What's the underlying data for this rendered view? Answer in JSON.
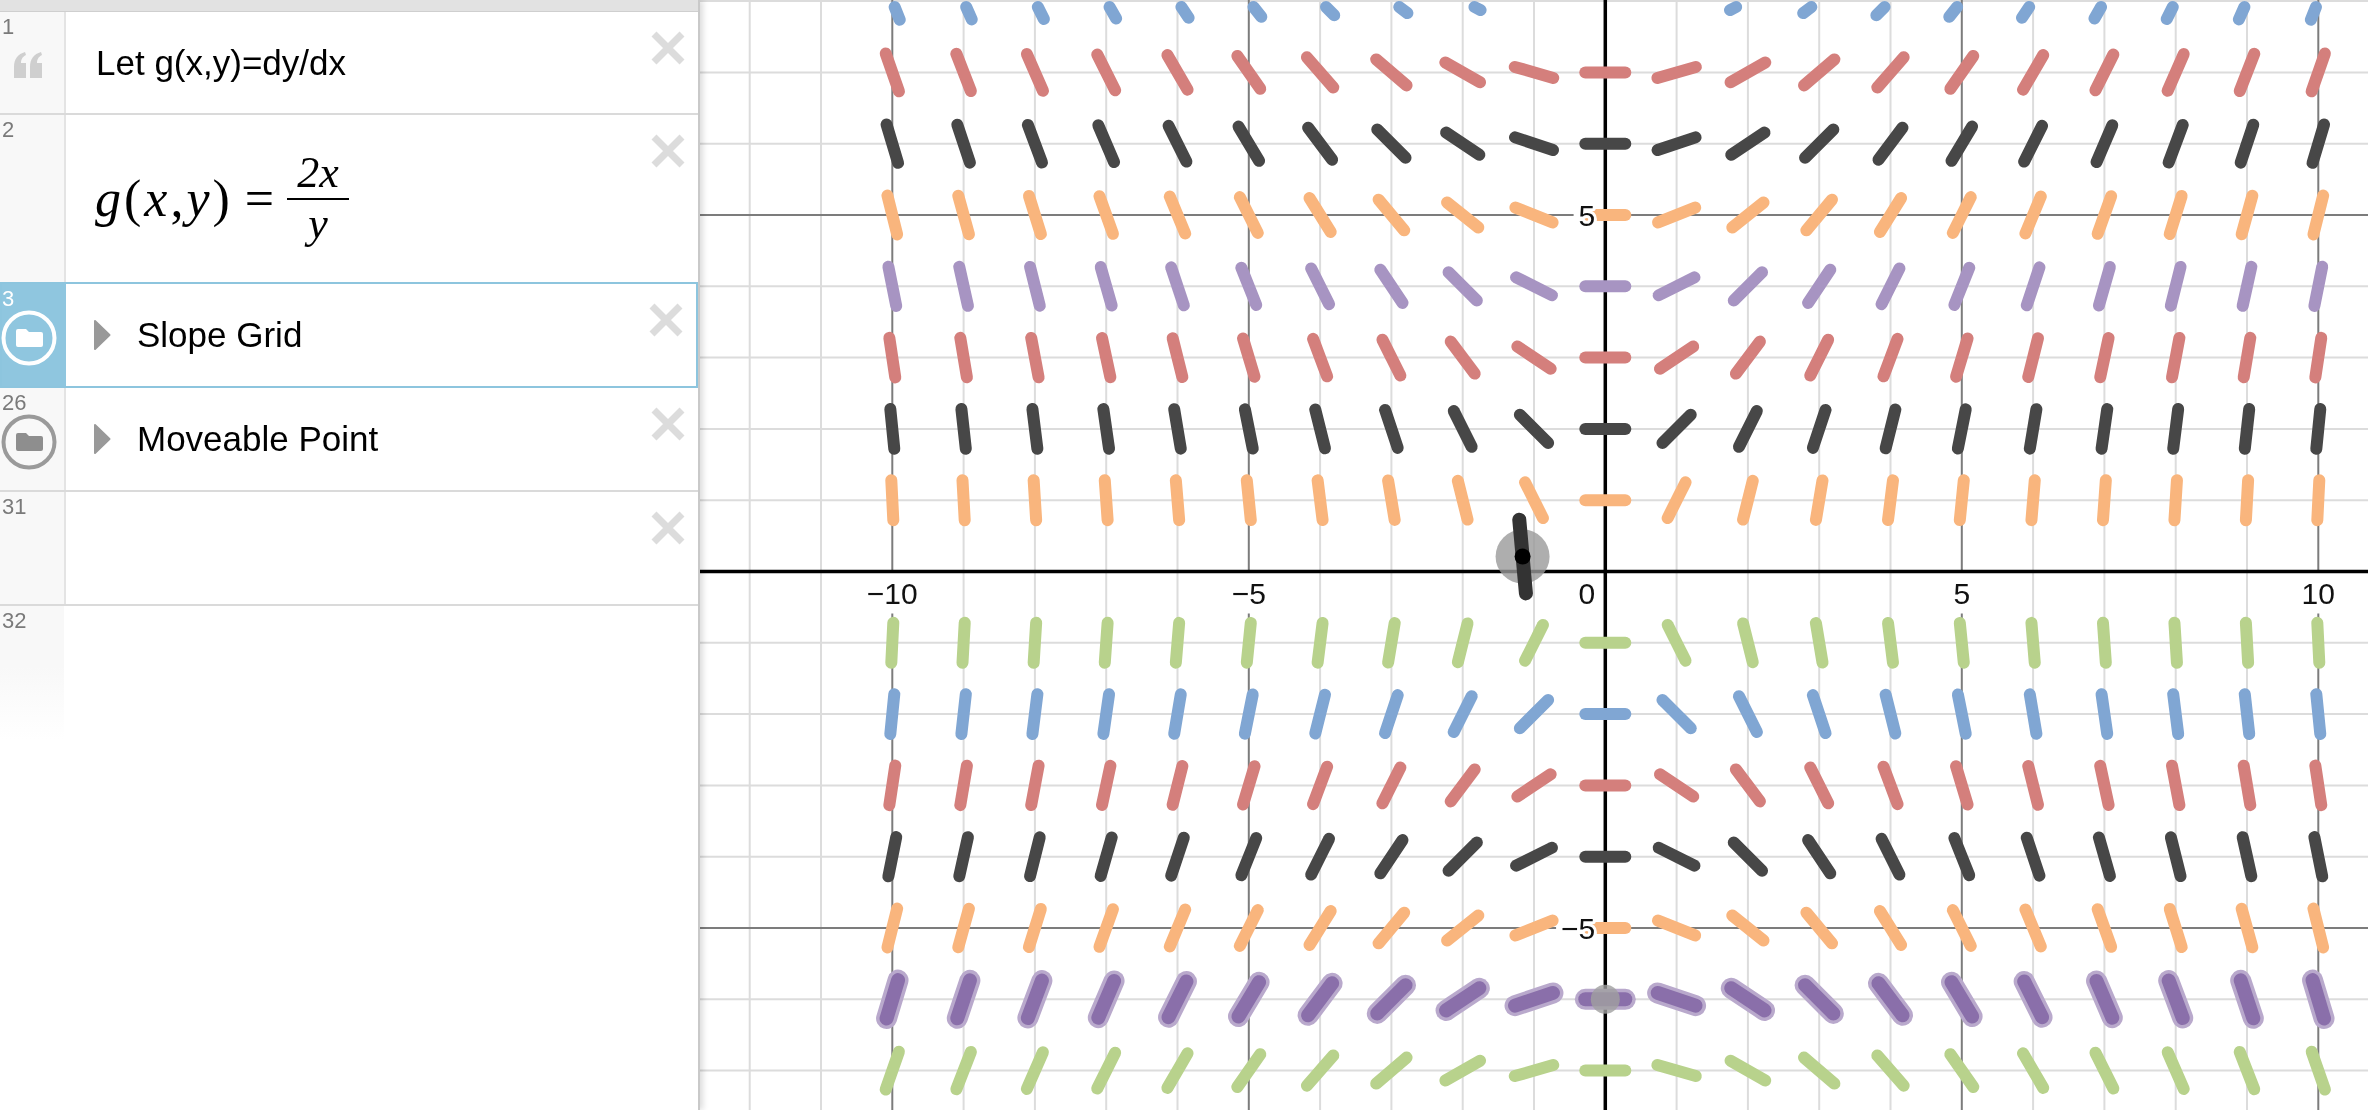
{
  "expression_list": {
    "items": [
      {
        "kind": "note",
        "number": "1",
        "text": "Let g(x,y)=dy/dx",
        "selected": false
      },
      {
        "kind": "expression",
        "number": "2",
        "math": {
          "lhs": "*g*(*x*,*y*)",
          "relation": "=",
          "numerator": "2x",
          "denominator": "y"
        },
        "selected": false
      },
      {
        "kind": "folder",
        "number": "3",
        "title": "Slope Grid",
        "expanded": false,
        "selected": true
      },
      {
        "kind": "folder",
        "number": "26",
        "title": "Moveable Point",
        "expanded": false,
        "selected": false
      },
      {
        "kind": "expression",
        "number": "31",
        "selected": false
      },
      {
        "kind": "blank",
        "number": "32",
        "selected": false
      }
    ]
  },
  "graph": {
    "x_tick_labels": [
      "−10",
      "−5",
      "0",
      "5",
      "10"
    ],
    "y_tick_labels": [
      "5",
      "−5"
    ],
    "slope_rows": [
      {
        "color": "#80a6d3",
        "emphasized": false
      },
      {
        "color": "#d47f7c",
        "emphasized": false
      },
      {
        "color": "#474747",
        "emphasized": false
      },
      {
        "color": "#f9b57d",
        "emphasized": false
      },
      {
        "color": "#a794c2",
        "emphasized": false
      },
      {
        "color": "#d47f7c",
        "emphasized": false
      },
      {
        "color": "#474747",
        "emphasized": false
      },
      {
        "color": "#f9b57d",
        "emphasized": false
      },
      {
        "color": "#b8d28c",
        "emphasized": false
      },
      {
        "color": "#80a6d3",
        "emphasized": false
      },
      {
        "color": "#d47f7c",
        "emphasized": false
      },
      {
        "color": "#474747",
        "emphasized": false
      },
      {
        "color": "#f9b57d",
        "emphasized": false
      },
      {
        "color": "#8a6faa",
        "emphasized": true
      },
      {
        "color": "#b8d28c",
        "emphasized": false
      }
    ]
  }
}
